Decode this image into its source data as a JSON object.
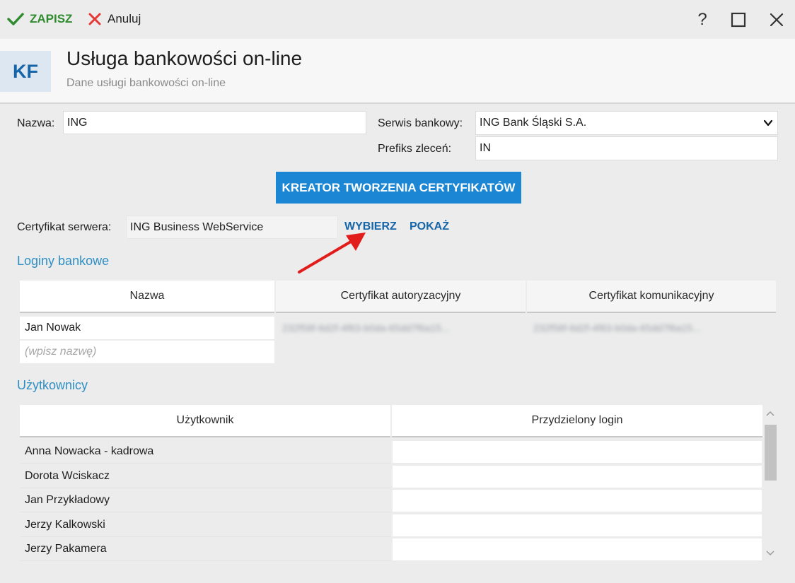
{
  "toolbar": {
    "save_label": "ZAPISZ",
    "cancel_label": "Anuluj",
    "help_label": "?",
    "close_label": "✕"
  },
  "header": {
    "logo_text": "KF",
    "title": "Usługa bankowości on-line",
    "subtitle": "Dane usługi bankowości on-line"
  },
  "form": {
    "name_label": "Nazwa:",
    "name_value": "ING",
    "bank_label": "Serwis bankowy:",
    "bank_value": "ING Bank Śląski S.A.",
    "prefix_label": "Prefiks zleceń:",
    "prefix_value": "IN",
    "wizard_button": "KREATOR TWORZENIA CERTYFIKATÓW",
    "cert_label": "Certyfikat serwera:",
    "cert_value": "ING Business WebService",
    "choose_button": "WYBIERZ",
    "show_button": "POKAŻ"
  },
  "logins": {
    "section_title": "Loginy bankowe",
    "columns": [
      "Nazwa",
      "Certyfikat autoryzacyjny",
      "Certyfikat komunikacyjny"
    ],
    "rows": [
      {
        "name": "Jan Nowak",
        "auth_cert": "232f58f-6d2f-4f83-b0da-65dd7f6a15...",
        "comm_cert": "232f58f-6d2f-4f83-b0da-65dd7f6a15..."
      }
    ],
    "new_row_placeholder": "(wpisz nazwę)"
  },
  "users": {
    "section_title": "Użytkownicy",
    "columns": [
      "Użytkownik",
      "Przydzielony login"
    ],
    "rows": [
      {
        "user": "Anna Nowacka - kadrowa",
        "login": ""
      },
      {
        "user": "Dorota Wciskacz",
        "login": ""
      },
      {
        "user": "Jan Przykładowy",
        "login": ""
      },
      {
        "user": "Jerzy Kalkowski",
        "login": ""
      },
      {
        "user": "Jerzy Pakamera",
        "login": ""
      }
    ]
  },
  "colors": {
    "accent": "#1b86d3",
    "link": "#1565a8",
    "section": "#2f8fc4",
    "save": "#2e8b2e",
    "cancel": "#e53935",
    "annotation_arrow": "#e21b1b"
  },
  "icons": {
    "save": "check-icon",
    "cancel": "x-icon",
    "maximize": "maximize-icon",
    "close": "close-icon",
    "dropdown": "chevron-down-icon"
  }
}
